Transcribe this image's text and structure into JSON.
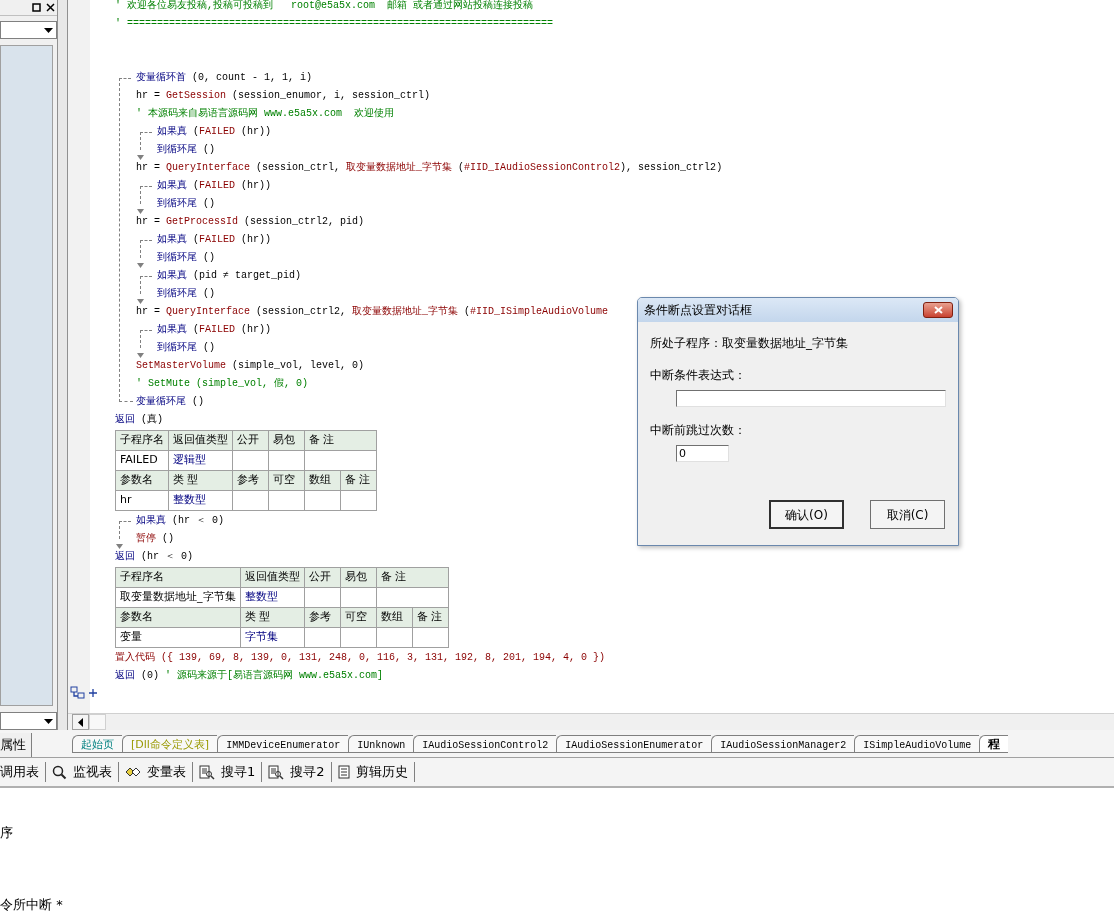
{
  "left_panel": {
    "tab": "属性"
  },
  "code": [
    {
      "kind": "line",
      "tokens": [
        {
          "kind": "cm",
          "t": "' 欢迎各位易友投稿,投稿可投稿到   root@e5a5x.com  邮箱 或者通过网站投稿连接投稿"
        }
      ]
    },
    {
      "kind": "line",
      "tokens": [
        {
          "kind": "cm",
          "t": "' ======================================================================="
        }
      ]
    },
    {
      "kind": "blank"
    },
    {
      "kind": "blank"
    },
    {
      "kind": "loop",
      "header": [
        {
          "kind": "kw",
          "t": "变量循环首"
        },
        {
          "kind": "tx",
          "t": " (0, count - 1, 1, i)"
        }
      ],
      "children": [
        {
          "kind": "line",
          "tokens": [
            {
              "kind": "tx",
              "t": "hr = "
            },
            {
              "kind": "fn",
              "t": "GetSession"
            },
            {
              "kind": "tx",
              "t": " (session_enumor, i, session_ctrl)"
            }
          ]
        },
        {
          "kind": "line",
          "tokens": [
            {
              "kind": "cm",
              "t": "' 本源码来自易语言源码网 www.e5a5x.com  欢迎使用"
            }
          ]
        },
        {
          "kind": "if",
          "header": [
            {
              "kind": "kw",
              "t": "如果真"
            },
            {
              "kind": "tx",
              "t": " ("
            },
            {
              "kind": "fn",
              "t": "FAILED"
            },
            {
              "kind": "tx",
              "t": " (hr))"
            }
          ],
          "children": [
            {
              "kind": "line",
              "tokens": [
                {
                  "kind": "kw",
                  "t": "到循环尾"
                },
                {
                  "kind": "tx",
                  "t": " ()"
                }
              ]
            }
          ]
        },
        {
          "kind": "line",
          "tokens": [
            {
              "kind": "tx",
              "t": "hr = "
            },
            {
              "kind": "fn",
              "t": "QueryInterface"
            },
            {
              "kind": "tx",
              "t": " (session_ctrl, "
            },
            {
              "kind": "fn",
              "t": "取变量数据地址_字节集"
            },
            {
              "kind": "tx",
              "t": " ("
            },
            {
              "kind": "fn",
              "t": "#IID_IAudioSessionControl2"
            },
            {
              "kind": "tx",
              "t": "), session_ctrl2)"
            }
          ]
        },
        {
          "kind": "if",
          "header": [
            {
              "kind": "kw",
              "t": "如果真"
            },
            {
              "kind": "tx",
              "t": " ("
            },
            {
              "kind": "fn",
              "t": "FAILED"
            },
            {
              "kind": "tx",
              "t": " (hr))"
            }
          ],
          "children": [
            {
              "kind": "line",
              "tokens": [
                {
                  "kind": "kw",
                  "t": "到循环尾"
                },
                {
                  "kind": "tx",
                  "t": " ()"
                }
              ]
            }
          ]
        },
        {
          "kind": "line",
          "tokens": [
            {
              "kind": "tx",
              "t": "hr = "
            },
            {
              "kind": "fn",
              "t": "GetProcessId"
            },
            {
              "kind": "tx",
              "t": " (session_ctrl2, pid)"
            }
          ]
        },
        {
          "kind": "if",
          "header": [
            {
              "kind": "kw",
              "t": "如果真"
            },
            {
              "kind": "tx",
              "t": " ("
            },
            {
              "kind": "fn",
              "t": "FAILED"
            },
            {
              "kind": "tx",
              "t": " (hr))"
            }
          ],
          "children": [
            {
              "kind": "line",
              "tokens": [
                {
                  "kind": "kw",
                  "t": "到循环尾"
                },
                {
                  "kind": "tx",
                  "t": " ()"
                }
              ]
            }
          ]
        },
        {
          "kind": "if",
          "header": [
            {
              "kind": "kw",
              "t": "如果真"
            },
            {
              "kind": "tx",
              "t": " (pid ≠ target_pid)"
            }
          ],
          "children": [
            {
              "kind": "line",
              "tokens": [
                {
                  "kind": "kw",
                  "t": "到循环尾"
                },
                {
                  "kind": "tx",
                  "t": " ()"
                }
              ]
            }
          ]
        },
        {
          "kind": "line",
          "tokens": [
            {
              "kind": "tx",
              "t": "hr = "
            },
            {
              "kind": "fn",
              "t": "QueryInterface"
            },
            {
              "kind": "tx",
              "t": " (session_ctrl2, "
            },
            {
              "kind": "fn",
              "t": "取变量数据地址_字节集"
            },
            {
              "kind": "tx",
              "t": " ("
            },
            {
              "kind": "fn",
              "t": "#IID_ISimpleAudioVolume"
            }
          ]
        },
        {
          "kind": "if",
          "header": [
            {
              "kind": "kw",
              "t": "如果真"
            },
            {
              "kind": "tx",
              "t": " ("
            },
            {
              "kind": "fn",
              "t": "FAILED"
            },
            {
              "kind": "tx",
              "t": " (hr))"
            }
          ],
          "children": [
            {
              "kind": "line",
              "tokens": [
                {
                  "kind": "kw",
                  "t": "到循环尾"
                },
                {
                  "kind": "tx",
                  "t": " ()"
                }
              ]
            }
          ]
        },
        {
          "kind": "line",
          "tokens": [
            {
              "kind": "fn",
              "t": "SetMasterVolume"
            },
            {
              "kind": "tx",
              "t": " (simple_vol, level, 0)"
            }
          ]
        },
        {
          "kind": "line",
          "tokens": [
            {
              "kind": "cm",
              "t": "' SetMute (simple_vol, 假, 0)"
            }
          ]
        }
      ],
      "footer": [
        {
          "kind": "kw",
          "t": "变量循环尾"
        },
        {
          "kind": "tx",
          "t": " ()"
        }
      ]
    },
    {
      "kind": "line",
      "tokens": [
        {
          "kind": "kw",
          "t": "返回"
        },
        {
          "kind": "tx",
          "t": " (真)"
        }
      ]
    },
    {
      "kind": "table",
      "sub_header": [
        "子程序名",
        "返回值类型",
        "公开",
        "易包",
        "备 注"
      ],
      "sub": {
        "name": "FAILED",
        "return_type": "逻辑型"
      },
      "param_header": [
        "参数名",
        "类 型",
        "参考",
        "可空",
        "数组",
        "备 注"
      ],
      "params": [
        {
          "name": "hr",
          "type": "整数型"
        }
      ]
    },
    {
      "kind": "if",
      "header": [
        {
          "kind": "kw",
          "t": "如果真"
        },
        {
          "kind": "tx",
          "t": " (hr ＜ 0)"
        }
      ],
      "children": [
        {
          "kind": "line",
          "tokens": [
            {
              "kind": "fn",
              "t": "暂停"
            },
            {
              "kind": "tx",
              "t": " ()"
            }
          ]
        }
      ]
    },
    {
      "kind": "line",
      "tokens": [
        {
          "kind": "kw",
          "t": "返回"
        },
        {
          "kind": "tx",
          "t": " (hr ＜ 0)"
        }
      ]
    },
    {
      "kind": "table",
      "sub_header": [
        "子程序名",
        "返回值类型",
        "公开",
        "易包",
        "备 注"
      ],
      "sub": {
        "name": "取变量数据地址_字节集",
        "return_type": "整数型"
      },
      "param_header": [
        "参数名",
        "类 型",
        "参考",
        "可空",
        "数组",
        "备 注"
      ],
      "params": [
        {
          "name": "变量",
          "type": "字节集"
        }
      ]
    },
    {
      "kind": "line",
      "tokens": [
        {
          "kind": "fn",
          "t": "置入代码"
        },
        {
          "kind": "num",
          "t": " ({ 139, 69, 8, 139, 0, 131, 248, 0, 116, 3, 131, 192, 8, 201, 194, 4, 0 })"
        }
      ]
    },
    {
      "kind": "line",
      "tokens": [
        {
          "kind": "kw",
          "t": "返回"
        },
        {
          "kind": "tx",
          "t": " (0) "
        },
        {
          "kind": "cm",
          "t": "' 源码来源于[易语言源码网 www.e5a5x.com]"
        }
      ]
    }
  ],
  "file_tabs": [
    {
      "label": "起始页",
      "kind": "start",
      "selected": false
    },
    {
      "label": "[Dll命令定义表]",
      "kind": "dll",
      "selected": false
    },
    {
      "label": "IMMDeviceEnumerator",
      "kind": "class",
      "selected": false
    },
    {
      "label": "IUnknown",
      "kind": "class",
      "selected": false
    },
    {
      "label": "IAudioSessionControl2",
      "kind": "class",
      "selected": false
    },
    {
      "label": "IAudioSessionEnumerator",
      "kind": "class",
      "selected": false
    },
    {
      "label": "IAudioSessionManager2",
      "kind": "class",
      "selected": false
    },
    {
      "label": "ISimpleAudioVolume",
      "kind": "class",
      "selected": false
    },
    {
      "label": "程",
      "kind": "program",
      "selected": true
    }
  ],
  "tool_tabs": [
    {
      "label": "调用表",
      "kind": "none"
    },
    {
      "label": "监视表",
      "kind": "watch"
    },
    {
      "label": "变量表",
      "kind": "vars"
    },
    {
      "label": "搜寻1",
      "kind": "find"
    },
    {
      "label": "搜寻2",
      "kind": "find"
    },
    {
      "label": "剪辑历史",
      "kind": "clip"
    }
  ],
  "output": [
    "序",
    "令所中断 *"
  ],
  "dialog": {
    "title": "条件断点设置对话框",
    "context_label": "所处子程序：取变量数据地址_字节集",
    "condition_label": "中断条件表达式：",
    "skip_label": "中断前跳过次数：",
    "skip_field": {
      "value": "0"
    },
    "buttons": [
      "确认(O)",
      "取消(C)"
    ]
  }
}
